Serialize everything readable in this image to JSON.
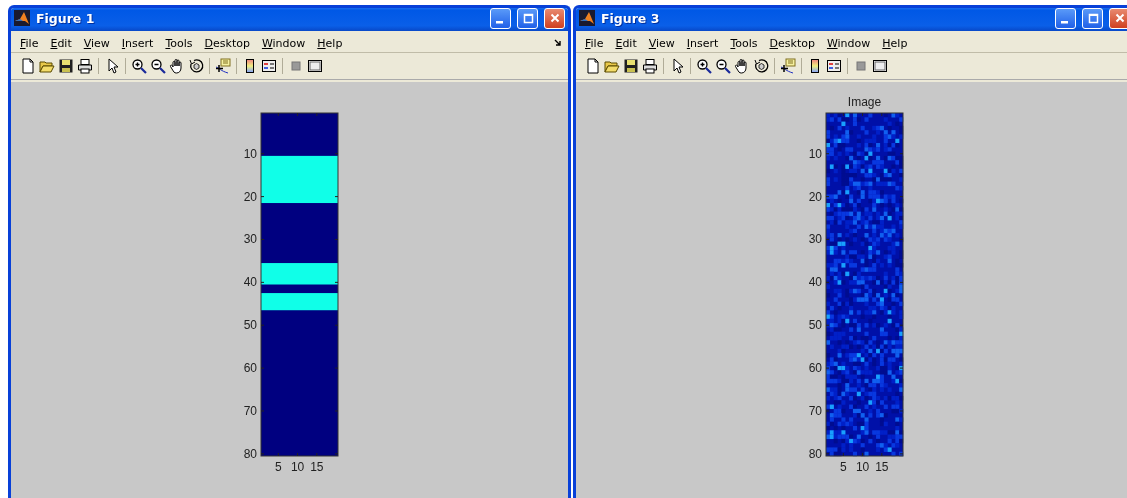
{
  "windows": [
    {
      "title": "Figure 1",
      "menu": [
        "File",
        "Edit",
        "View",
        "Insert",
        "Tools",
        "Desktop",
        "Window",
        "Help"
      ],
      "dock_button": true,
      "axes": {
        "image": {
          "kind": "bands"
        },
        "yticks": [
          "10",
          "20",
          "30",
          "40",
          "50",
          "60",
          "70",
          "80"
        ],
        "xticks": [
          "5",
          "10",
          "15"
        ]
      }
    },
    {
      "title": "Figure 3",
      "menu": [
        "File",
        "Edit",
        "View",
        "Insert",
        "Tools",
        "Desktop",
        "Window",
        "Help"
      ],
      "dock_button": false,
      "axes": {
        "title": "Image",
        "image": {
          "kind": "noise"
        },
        "yticks": [
          "10",
          "20",
          "30",
          "40",
          "50",
          "60",
          "70",
          "80"
        ],
        "xticks": [
          "5",
          "10",
          "15"
        ]
      }
    }
  ]
}
